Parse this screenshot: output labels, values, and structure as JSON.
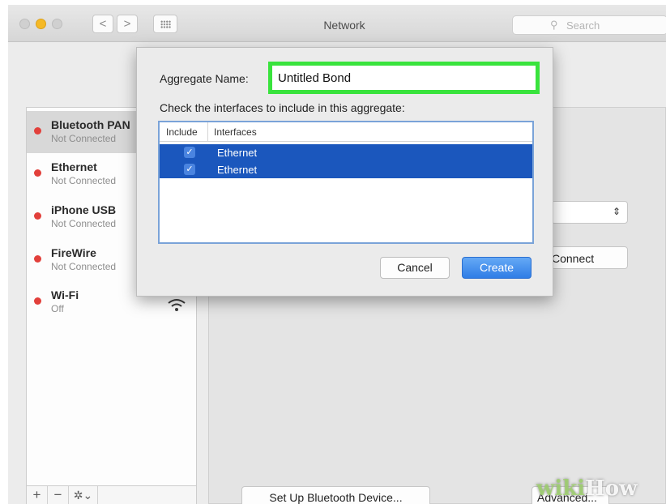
{
  "window": {
    "title": "Network",
    "search_placeholder": "Search",
    "back_glyph": "<",
    "forward_glyph": ">"
  },
  "sidebar": {
    "services": [
      {
        "name": "Bluetooth PAN",
        "status": "Not Connected",
        "status_color": "#e2403b"
      },
      {
        "name": "Ethernet",
        "status": "Not Connected",
        "status_color": "#e2403b"
      },
      {
        "name": "iPhone USB",
        "status": "Not Connected",
        "status_color": "#e2403b"
      },
      {
        "name": "FireWire",
        "status": "Not Connected",
        "status_color": "#e2403b"
      },
      {
        "name": "Wi-Fi",
        "status": "Off",
        "status_color": "#e2403b"
      }
    ],
    "add_glyph": "+",
    "remove_glyph": "−",
    "action_glyph": "✲⌄"
  },
  "panel": {
    "connect_label": "Connect",
    "setup_bluetooth_label": "Set Up Bluetooth Device...",
    "advanced_label": "Advanced..."
  },
  "dialog": {
    "aggregate_label": "Aggregate Name:",
    "aggregate_value": "Untitled Bond",
    "check_label": "Check the interfaces to include in this aggregate:",
    "columns": [
      "Include",
      "Interfaces"
    ],
    "rows": [
      {
        "include": true,
        "interface": "Ethernet"
      },
      {
        "include": true,
        "interface": "Ethernet"
      }
    ],
    "cancel_label": "Cancel",
    "create_label": "Create"
  },
  "colors": {
    "highlight": "#39e33d",
    "selection": "#1b57bd",
    "accent": "#2f7de6"
  },
  "watermark": {
    "part1": "wiki",
    "part2": "How"
  }
}
